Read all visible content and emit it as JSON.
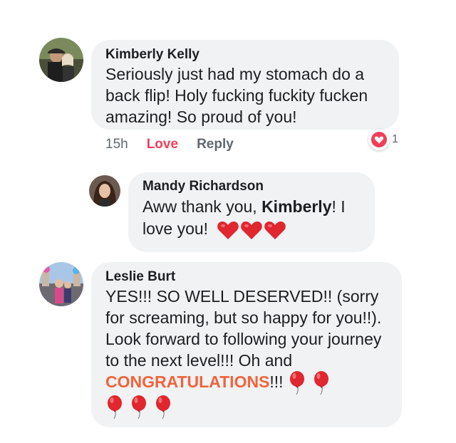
{
  "comments": [
    {
      "author": "Kimberly Kelly",
      "text": "Seriously just had my stomach do a back flip!  Holy fucking fuckity fucken amazing!  So proud of you!",
      "time": "15h",
      "love_label": "Love",
      "reply_label": "Reply",
      "reaction_count": "1"
    },
    {
      "author": "Mandy Richardson",
      "text_before": "Aww thank you, ",
      "mention": "Kimberly",
      "text_after": "! I love you!"
    },
    {
      "author": "Leslie Burt",
      "text": "YES!!!  SO WELL DESERVED!! (sorry for screaming, but so happy for you!!). Look forward to following your journey to the next level!!!  Oh and ",
      "highlight": "CONGRATULATIONS",
      "after_highlight": "!!!"
    }
  ],
  "colors": {
    "love": "#f33e58",
    "bubble": "#f1f2f4",
    "congrats": "#f0643c"
  }
}
